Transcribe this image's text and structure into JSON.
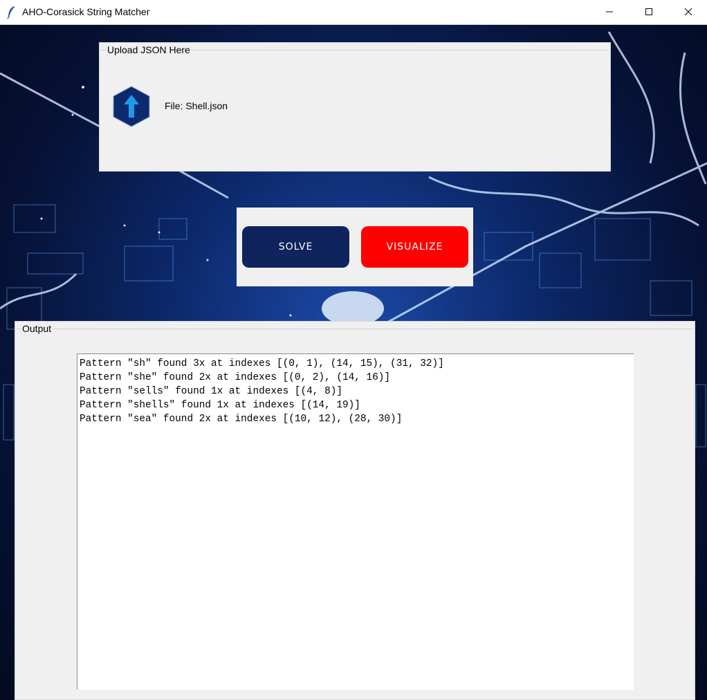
{
  "window": {
    "title": "AHO-Corasick String Matcher",
    "controls": [
      "minimize",
      "maximize",
      "close"
    ]
  },
  "upload": {
    "legend": "Upload JSON Here",
    "file_label": "File: Shell.json",
    "icon": "upload-arrow-icon"
  },
  "actions": {
    "solve_label": "SOLVE",
    "visualize_label": "VISUALIZE",
    "solve_color": "#0f235c",
    "visualize_color": "#ff0000"
  },
  "output": {
    "legend": "Output",
    "lines": [
      "Pattern \"sh\" found 3x at indexes [(0, 1), (14, 15), (31, 32)]",
      "Pattern \"she\" found 2x at indexes [(0, 2), (14, 16)]",
      "Pattern \"sells\" found 1x at indexes [(4, 8)]",
      "Pattern \"shells\" found 1x at indexes [(14, 19)]",
      "Pattern \"sea\" found 2x at indexes [(10, 12), (28, 30)]"
    ]
  }
}
